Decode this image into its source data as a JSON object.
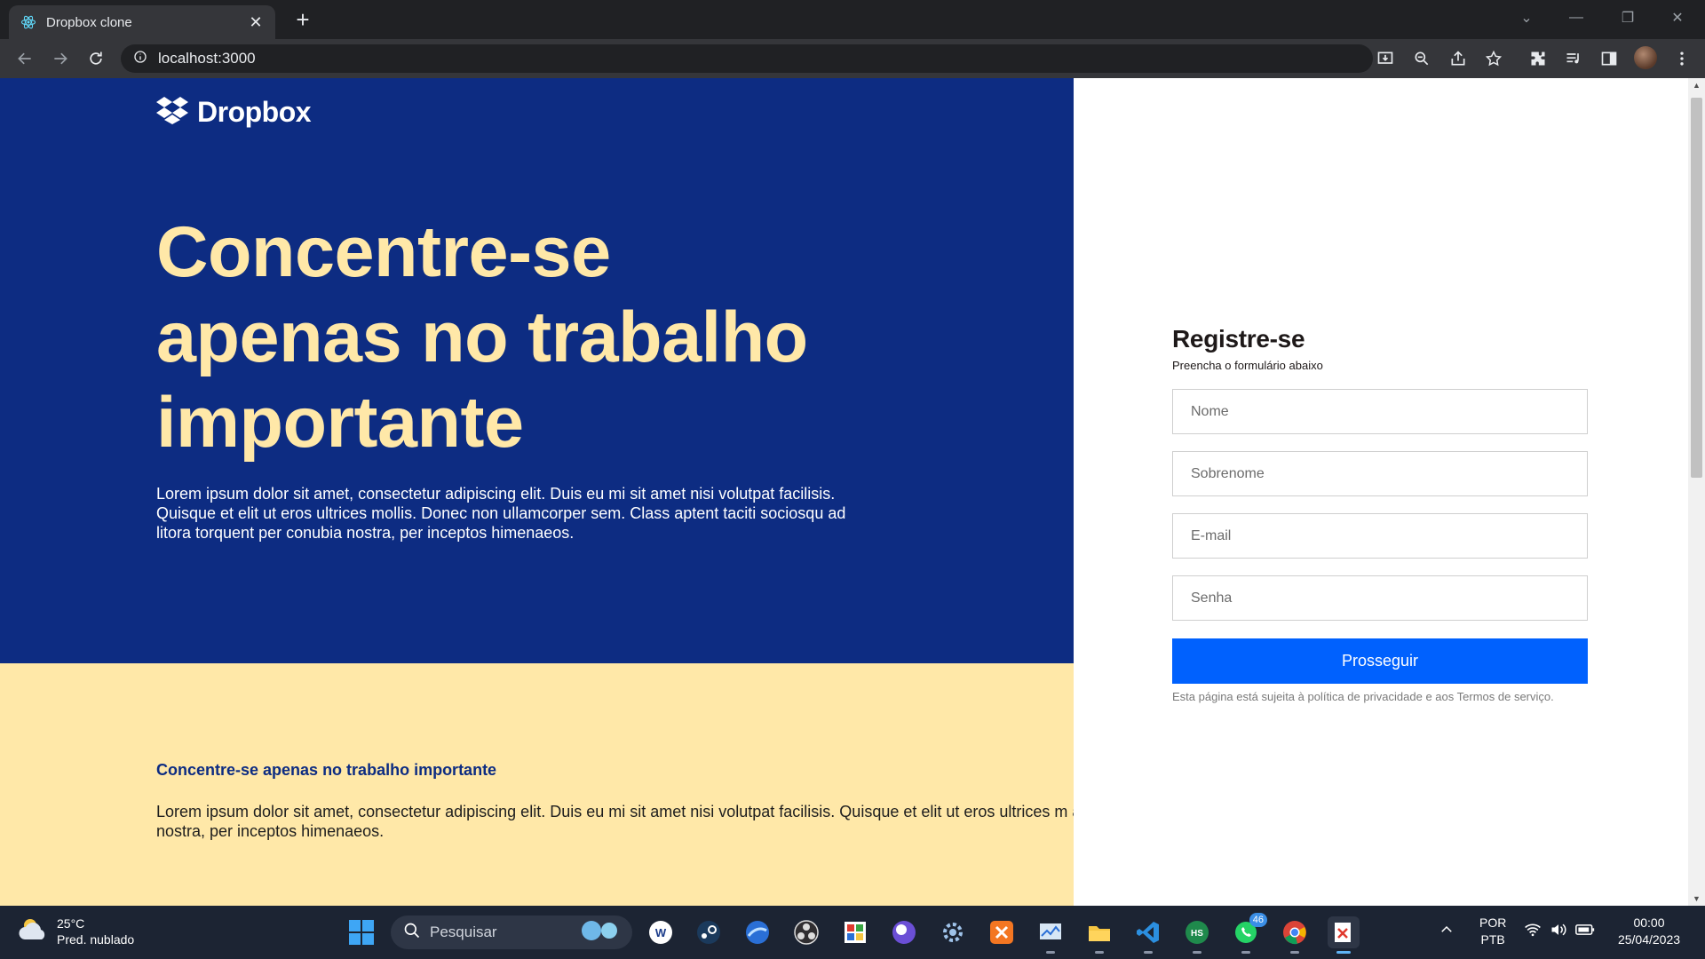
{
  "browser": {
    "tab_title": "Dropbox clone",
    "url": "localhost:3000"
  },
  "page": {
    "logo_text": "Dropbox",
    "headline": "Concentre-se apenas no trabalho importante",
    "hero_text": "Lorem ipsum dolor sit amet, consectetur adipiscing elit. Duis eu mi sit amet nisi volutpat facilisis. Quisque et elit ut eros ultrices mollis. Donec non ullamcorper sem. Class aptent taciti sociosqu ad litora torquent per conubia nostra, per inceptos himenaeos.",
    "lower_title": "Concentre-se apenas no trabalho importante",
    "lower_text": "Lorem ipsum dolor sit amet, consectetur adipiscing elit. Duis eu mi sit amet nisi volutpat facilisis. Quisque et elit ut eros ultrices m ad litora torquent per conubia nostra, per inceptos himenaeos."
  },
  "form": {
    "title": "Registre-se",
    "subtitle": "Preencha o formulário abaixo",
    "first_name_placeholder": "Nome",
    "last_name_placeholder": "Sobrenome",
    "email_placeholder": "E-mail",
    "password_placeholder": "Senha",
    "submit_label": "Prosseguir",
    "terms": "Esta página está sujeita à política de privacidade e aos Termos de serviço."
  },
  "colors": {
    "hero_bg": "#0d2c82",
    "accent_yellow": "#ffe8a8",
    "button_blue": "#0061fe"
  },
  "taskbar": {
    "weather_temp": "25°C",
    "weather_desc": "Pred. nublado",
    "search_label": "Pesquisar",
    "whatsapp_badge": "46",
    "lang_1": "POR",
    "lang_2": "PTB",
    "time": "00:00",
    "date": "25/04/2023",
    "apps": [
      "windows-start-icon",
      "pesquisar-search",
      "vpn-icon",
      "steam-icon",
      "browser-icon",
      "obs-icon",
      "paint-icon",
      "orb-icon",
      "gear-app-icon",
      "xampp-icon",
      "monitor-icon",
      "file-explorer-icon",
      "vscode-icon",
      "hs-icon",
      "whatsapp-icon",
      "chrome-icon",
      "snipping-icon"
    ]
  }
}
